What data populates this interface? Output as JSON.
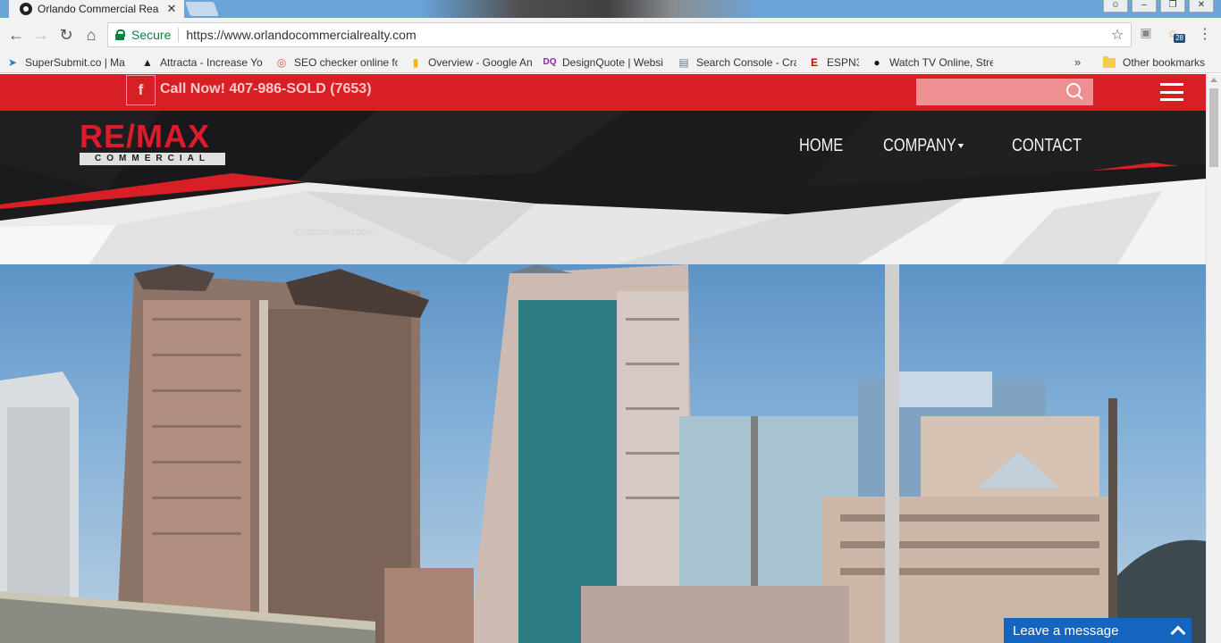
{
  "browser": {
    "tab_title": "Orlando Commercial Rea",
    "tab_close": "✕",
    "secure_label": "Secure",
    "url": "https://www.orlandocommercialrealty.com",
    "weather_badge": "28",
    "bookmarks": [
      {
        "label": "SuperSubmit.co | Ma",
        "icon": "arrow-icon",
        "color": "#2b7bd6"
      },
      {
        "label": "Attracta - Increase Yo",
        "icon": "attracta-icon",
        "color": "#222222"
      },
      {
        "label": "SEO checker online fo",
        "icon": "seo-icon",
        "color": "#d9534f"
      },
      {
        "label": "Overview - Google An",
        "icon": "analytics-icon",
        "color": "#f4b400"
      },
      {
        "label": "DesignQuote | Websi",
        "icon": "dq-icon",
        "color": "#8e24aa"
      },
      {
        "label": "Search Console - Cra",
        "icon": "search-console-icon",
        "color": "#607d8b"
      },
      {
        "label": "ESPN3",
        "icon": "espn-icon",
        "color": "#d50000"
      },
      {
        "label": "Watch TV Online, Stre",
        "icon": "play-icon",
        "color": "#111111"
      }
    ],
    "bookmarks_more": "»",
    "other_bookmarks": "Other bookmarks"
  },
  "site": {
    "facebook_glyph": "f",
    "call_now": "Call Now! 407-986-SOLD (7653)",
    "logo_top": "RE/MAX",
    "logo_bottom": "COMMERCIAL",
    "nav": {
      "home": "HOME",
      "company": "COMPANY",
      "contact": "CONTACT"
    },
    "selection_hint": "Custom Selection...",
    "chat_label": "Leave a message"
  },
  "colors": {
    "brand_red": "#d81f26",
    "header_dark": "#1b1b1d",
    "chat_blue": "#1565c0"
  }
}
